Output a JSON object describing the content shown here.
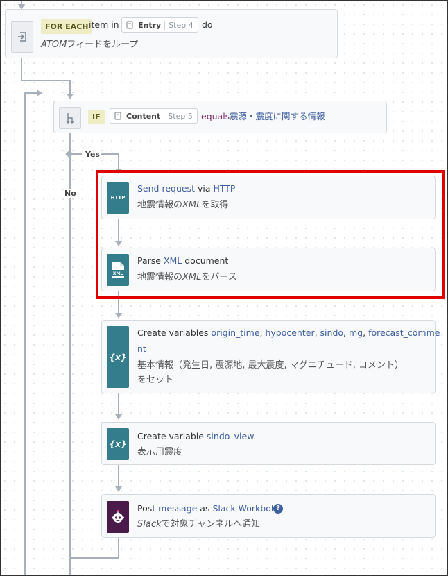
{
  "loop": {
    "keyword": "FOR EACH",
    "item_text": "item in",
    "pill_name": "Entry",
    "pill_step": "Step 4",
    "do_text": "do",
    "desc_em": "ATOM",
    "desc_rest": "フィードをループ"
  },
  "condition": {
    "keyword": "IF",
    "pill_name": "Content",
    "pill_step": "Step 5",
    "operator": "equals",
    "value": "震源・震度に関する情報",
    "yes_label": "Yes",
    "no_label": "No"
  },
  "steps": [
    {
      "icon_name": "http-icon",
      "icon_text": "HTTP",
      "title": [
        "Send request",
        " via ",
        "HTTP"
      ],
      "sub_pre": "地震情報の",
      "sub_em": "XML",
      "sub_post": "を取得"
    },
    {
      "icon_name": "xml-document-icon",
      "icon_text": "XML",
      "title": [
        "Parse ",
        "XML",
        " document"
      ],
      "sub_pre": "地震情報の",
      "sub_em": "XML",
      "sub_post": "をパース"
    },
    {
      "icon_name": "variables-icon",
      "icon_text": "{x}",
      "title_prefix": "Create variables ",
      "var_list": [
        "origin_time",
        "hypocenter",
        "sindo",
        "mg",
        "forecast_comme"
      ],
      "title_wrap": "nt",
      "sub_line1": "基本情報（発生日, 震源地, 最大震度, マグニチュード, コメント）",
      "sub_line2": "をセット"
    },
    {
      "icon_name": "variable-icon",
      "icon_text": "{x}",
      "title": [
        "Create variable ",
        "sindo_view"
      ],
      "sub": "表示用震度"
    },
    {
      "icon_name": "slack-workbot-icon",
      "title": [
        "Post ",
        "message",
        " as ",
        "Slack Workbot"
      ],
      "help_icon": "?",
      "sub_em": "Slack",
      "sub_post": "で対象チャンネルへ通知"
    }
  ],
  "colors": {
    "teal": "#347d8c",
    "link_blue": "#3e5fa0",
    "highlight_red": "#e00000",
    "keyword_tag": "#efedc6"
  }
}
